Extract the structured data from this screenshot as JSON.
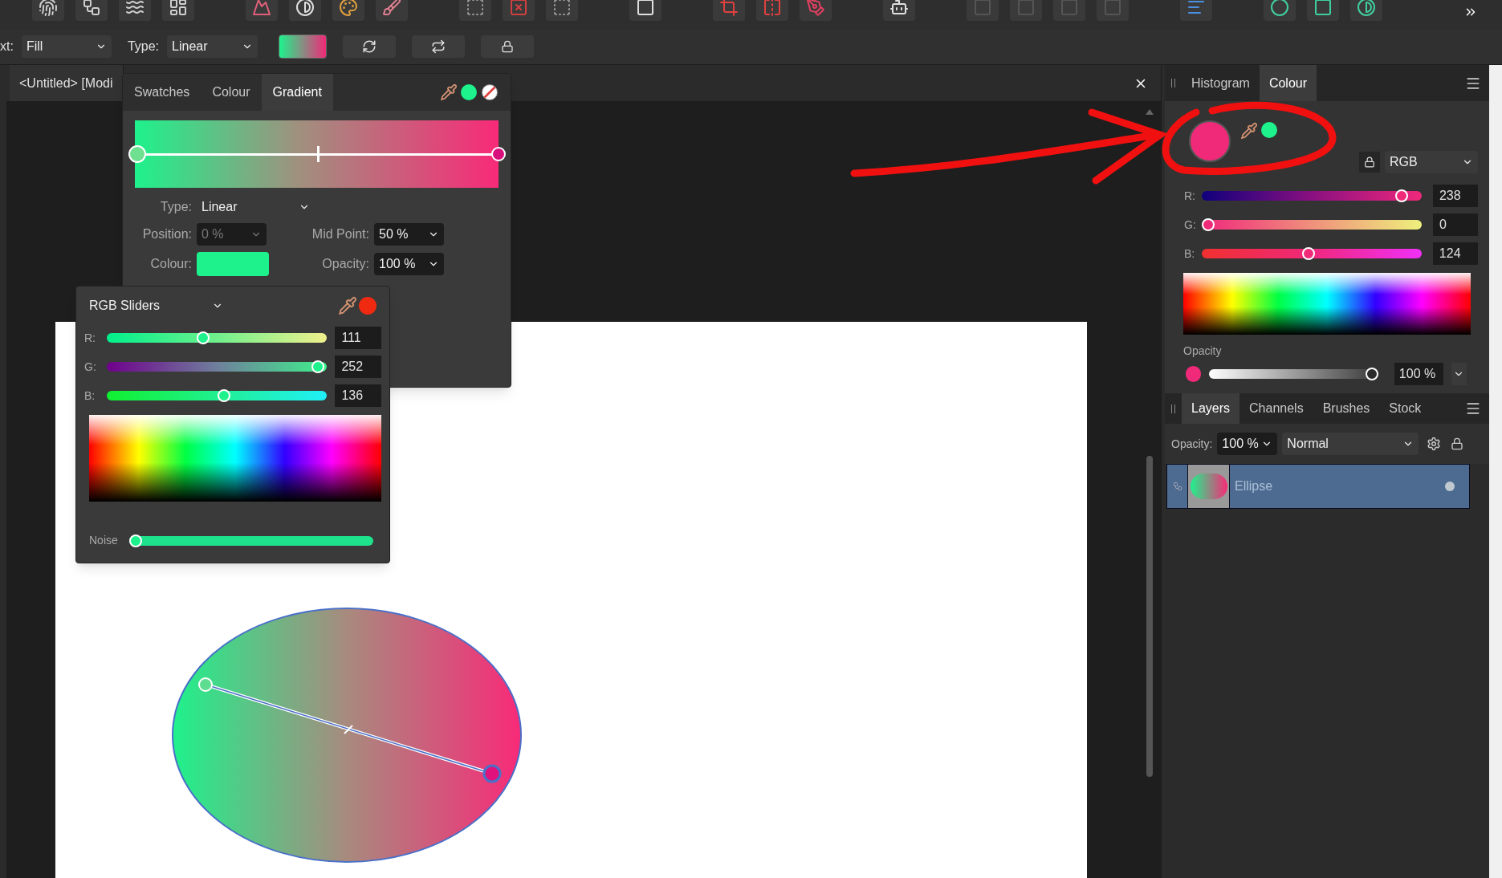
{
  "context_bar": {
    "target_label": "xt:",
    "target_value": "Fill",
    "type_label": "Type:",
    "type_value": "Linear"
  },
  "document_tab": {
    "title": "<Untitled> [Modi"
  },
  "gradient_popup": {
    "tabs": [
      {
        "label": "Swatches",
        "selected": false
      },
      {
        "label": "Colour",
        "selected": false
      },
      {
        "label": "Gradient",
        "selected": true
      }
    ],
    "midpoint": {
      "level": 0.5
    },
    "type_label": "Type:",
    "type_value": "Linear",
    "position_label": "Position:",
    "position_value": "0 %",
    "position_disabled": true,
    "midpoint_label": "Mid Point:",
    "midpoint_value": "50 %",
    "colour_label": "Colour:",
    "opacity_label": "Opacity:",
    "opacity_value": "100 %"
  },
  "colour_picker": {
    "mode": "RGB Sliders",
    "sliders": [
      {
        "label": "R:",
        "value": "111",
        "level": 0.435
      },
      {
        "label": "G:",
        "value": "252",
        "level": 0.988
      },
      {
        "label": "B:",
        "value": "136",
        "level": 0.533
      }
    ],
    "noise": {
      "label": "Noise",
      "level": 0
    }
  },
  "colour_panel": {
    "tabs": [
      {
        "label": "Histogram",
        "selected": false
      },
      {
        "label": "Colour",
        "selected": true
      }
    ],
    "model": "RGB",
    "sliders": [
      {
        "label": "R:",
        "value": "238",
        "level": 0.933
      },
      {
        "label": "G:",
        "value": "0",
        "level": 0
      },
      {
        "label": "B:",
        "value": "124",
        "level": 0.486
      }
    ],
    "opacity_label": "Opacity",
    "opacity_value": "100 %",
    "opacity_slider": {
      "level": 1
    }
  },
  "layers_panel": {
    "tabs": [
      {
        "label": "Layers",
        "selected": true
      },
      {
        "label": "Channels",
        "selected": false
      },
      {
        "label": "Brushes",
        "selected": false
      },
      {
        "label": "Stock",
        "selected": false
      }
    ],
    "opacity_label": "Opacity:",
    "opacity_value": "100 %",
    "blend_mode": "Normal",
    "layers": [
      {
        "name": "Ellipse",
        "selected": true
      }
    ]
  }
}
